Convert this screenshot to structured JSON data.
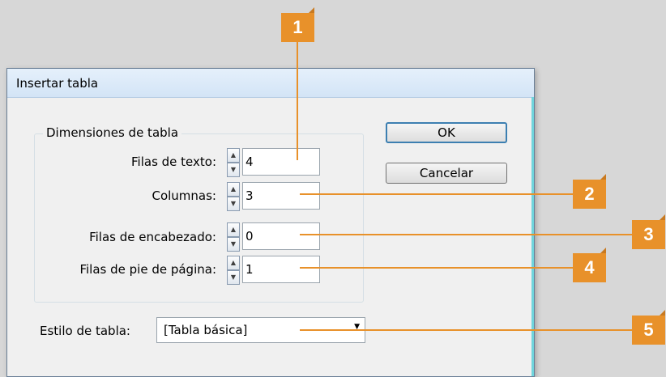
{
  "dialog": {
    "title": "Insertar tabla",
    "group": {
      "title": "Dimensiones de tabla",
      "fields": [
        {
          "label": "Filas de texto:",
          "value": "4"
        },
        {
          "label": "Columnas:",
          "value": "3"
        },
        {
          "label": "Filas de encabezado:",
          "value": "0"
        },
        {
          "label": "Filas de pie de página:",
          "value": "1"
        }
      ]
    },
    "ok_label": "OK",
    "cancel_label": "Cancelar",
    "style": {
      "label": "Estilo de tabla:",
      "value": "[Tabla básica]"
    }
  },
  "callouts": [
    "1",
    "2",
    "3",
    "4",
    "5"
  ],
  "colors": {
    "callout": "#e8912a",
    "leader": "#e8912a",
    "accent_edge": "#6fd4dc"
  }
}
